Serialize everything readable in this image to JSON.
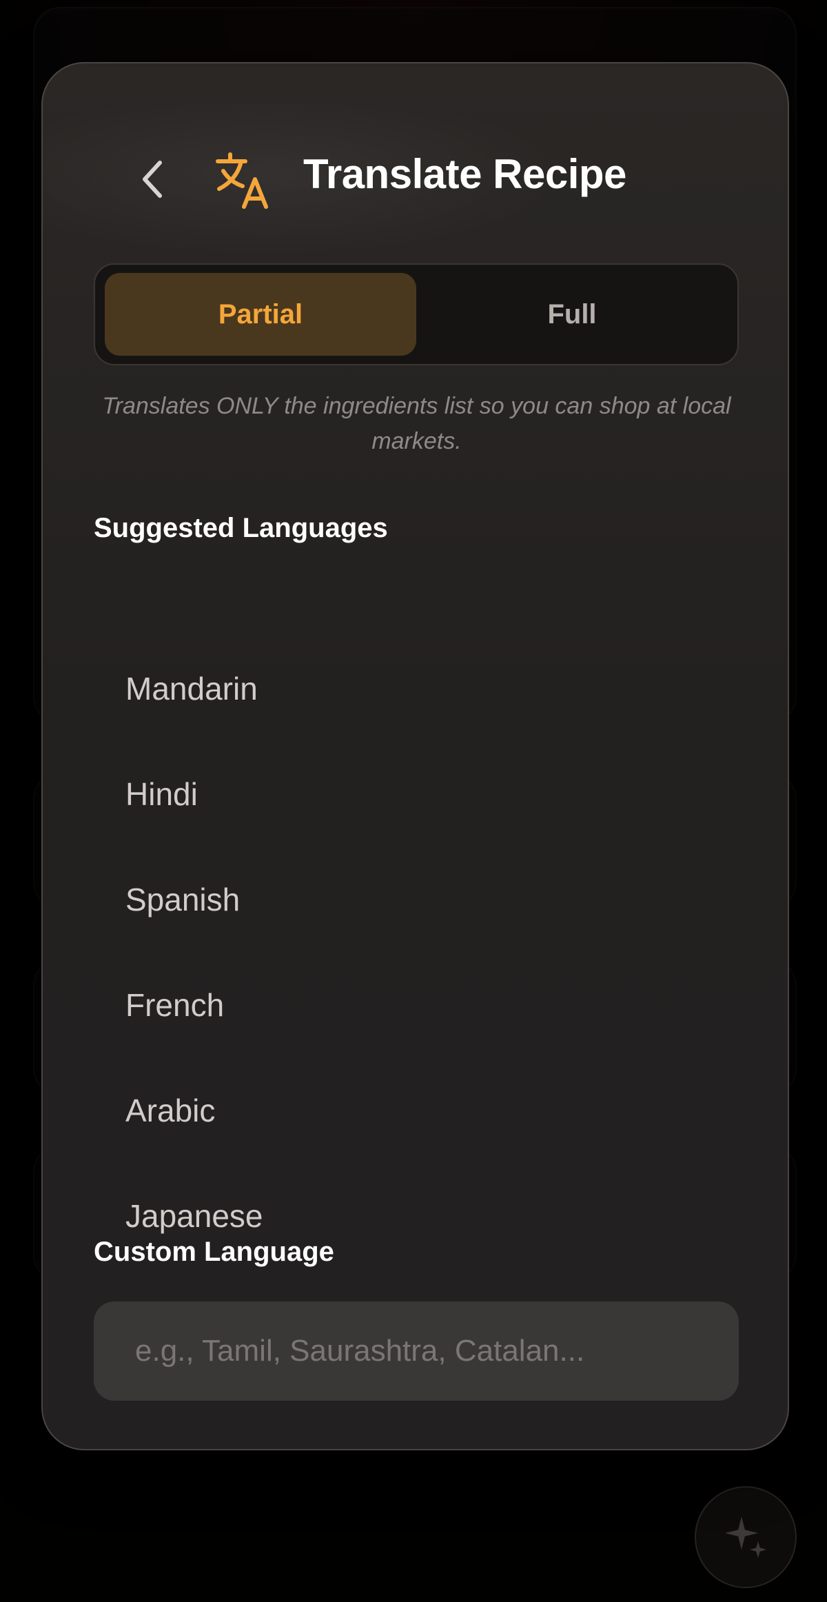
{
  "modal": {
    "title": "Translate Recipe",
    "mode_toggle": {
      "options": [
        "Partial",
        "Full"
      ],
      "selected": "Partial"
    },
    "description": "Translates ONLY the ingredients list so you can shop at local markets.",
    "suggested_label": "Suggested Languages",
    "languages": [
      "Mandarin",
      "Hindi",
      "Spanish",
      "French",
      "Arabic",
      "Japanese"
    ],
    "custom_label": "Custom Language",
    "custom_placeholder": "e.g., Tamil, Saurashtra, Catalan..."
  },
  "icons": {
    "back": "chevron-left-icon",
    "translate": "translate-icon",
    "fab": "sparkles-icon"
  },
  "colors": {
    "accent": "#f5a63a",
    "selected_segment": "#4a381e"
  }
}
